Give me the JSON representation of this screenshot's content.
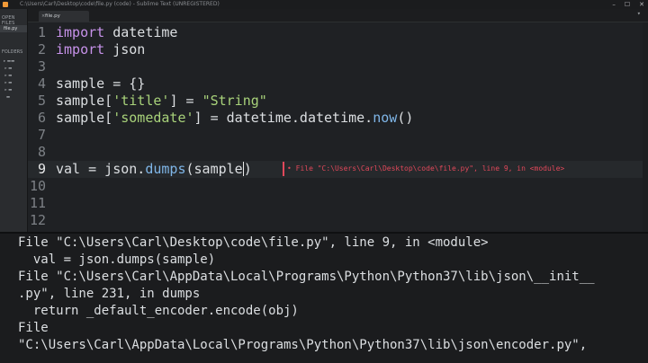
{
  "window": {
    "title": "C:\\Users\\Carl\\Desktop\\code\\file.py (code) - Sublime Text (UNREGISTERED)",
    "controls": [
      "–",
      "☐",
      "✕"
    ]
  },
  "sidebar": {
    "open_files_label": "OPEN FILES",
    "open_file": "file.py",
    "folders_label": "FOLDERS"
  },
  "tab": {
    "label": "file.py",
    "close_glyph": "×",
    "dropdown_glyph": "▾"
  },
  "editor": {
    "line_numbers": [
      "1",
      "2",
      "3",
      "4",
      "5",
      "6",
      "7",
      "8",
      "9",
      "10",
      "11",
      "12"
    ],
    "active_line": "9",
    "lines": {
      "l1_kw": "import",
      "l1_rest": " datetime",
      "l2_kw": "import",
      "l2_rest": " json",
      "l4_a": "sample",
      "l4_b": " = {}",
      "l5_a": "sample[",
      "l5_str": "'title'",
      "l5_b": "] = ",
      "l5_str2": "\"String\"",
      "l6_a": "sample[",
      "l6_str": "'somedate'",
      "l6_b": "] = datetime.datetime.",
      "l6_fn": "now",
      "l6_c": "()",
      "l9_a": "val = json.",
      "l9_fn": "dumps",
      "l9_b": "(sample",
      "l9_c": ")"
    },
    "inline_error": "• File \"C:\\Users\\Carl\\Desktop\\code\\file.py\", line 9, in <module>"
  },
  "output": {
    "lines": [
      "File \"C:\\Users\\Carl\\Desktop\\code\\file.py\", line 9, in <module>",
      "  val = json.dumps(sample)",
      "File \"C:\\Users\\Carl\\AppData\\Local\\Programs\\Python\\Python37\\lib\\json\\__init__",
      ".py\", line 231, in dumps",
      "  return _default_encoder.encode(obj)",
      "File",
      "\"C:\\Users\\Carl\\AppData\\Local\\Programs\\Python\\Python37\\lib\\json\\encoder.py\","
    ]
  }
}
